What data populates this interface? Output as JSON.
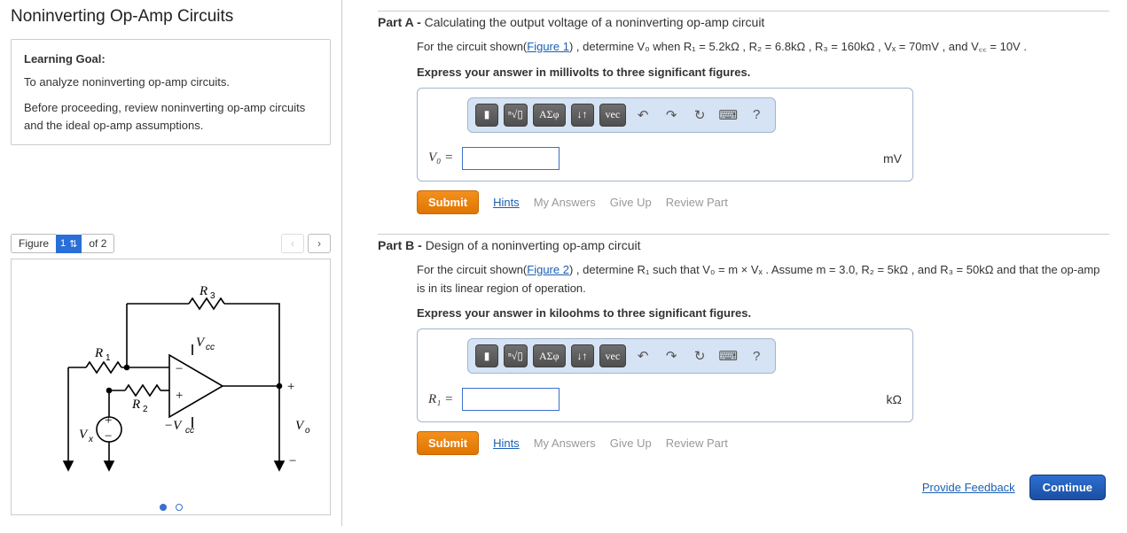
{
  "left": {
    "title": "Noninverting Op-Amp Circuits",
    "goal_heading": "Learning Goal:",
    "goal_text": "To analyze noninverting op-amp circuits.",
    "goal_note": "Before proceeding, review noninverting op-amp circuits and the ideal op-amp assumptions.",
    "figure_label": "Figure",
    "figure_current": "1",
    "figure_total": "of 2",
    "diagram": {
      "R1": "R₁",
      "R2": "R₂",
      "R3": "R₃",
      "Vcc_pos": "V",
      "Vcc_pos_sub": "cc",
      "Vcc_neg": "−V",
      "Vcc_neg_sub": "cc",
      "Vx": "V",
      "Vx_sub": "x",
      "Vo": "V",
      "Vo_sub": "o",
      "out_plus": "+",
      "out_minus": "−"
    }
  },
  "partA": {
    "header_bold": "Part A - ",
    "header_rest": "Calculating the output voltage of a noninverting op-amp circuit",
    "body_pre": "For the circuit shown(",
    "fig_link": "Figure 1",
    "body_post": ") , determine V₀  when  R₁ = 5.2kΩ , R₂ = 6.8kΩ , R₃ = 160kΩ , Vₓ = 70mV , and V꜀꜀ = 10V .",
    "instruction": "Express your answer in millivolts to three significant figures.",
    "var_label": "V₀ =",
    "unit": "mV"
  },
  "partB": {
    "header_bold": "Part B - ",
    "header_rest": "Design of a noninverting op-amp circuit",
    "body_pre": "For the circuit shown(",
    "fig_link": "Figure 2",
    "body_post": ") , determine R₁ such that V₀ = m × Vₓ . Assume m = 3.0, R₂ = 5kΩ , and R₃ = 50kΩ and that the op-amp is in its linear region of operation.",
    "instruction": "Express your answer in kiloohms to three significant figures.",
    "var_label": "R₁ =",
    "unit": "kΩ"
  },
  "toolbar": {
    "template": "▮",
    "sqrt": "ⁿ√▯",
    "greek": "ΑΣφ",
    "arrows": "↓↑",
    "vec": "vec",
    "undo": "↶",
    "redo": "↷",
    "reset": "↻",
    "keyboard": "⌨",
    "help": "?"
  },
  "actions": {
    "submit": "Submit",
    "hints": "Hints",
    "my_answers": "My Answers",
    "give_up": "Give Up",
    "review": "Review Part"
  },
  "footer": {
    "feedback": "Provide Feedback",
    "continue": "Continue"
  }
}
